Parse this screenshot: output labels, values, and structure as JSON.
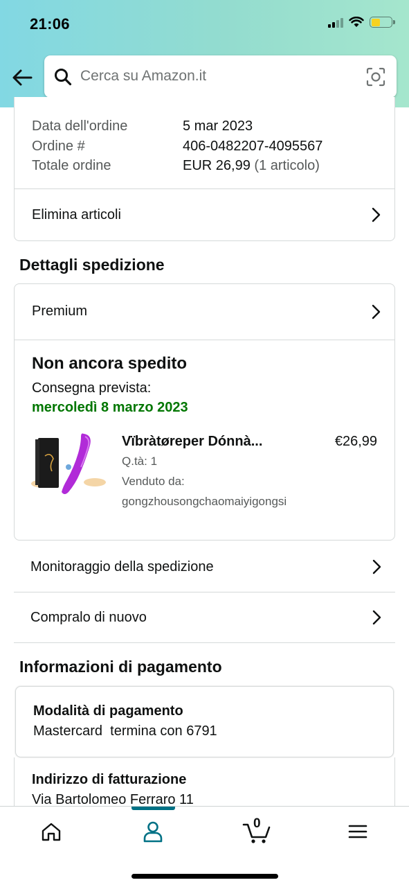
{
  "status_bar": {
    "time": "21:06"
  },
  "search": {
    "placeholder": "Cerca su Amazon.it"
  },
  "order": {
    "date_label": "Data dell'ordine",
    "date_value": "5 mar 2023",
    "number_label": "Ordine #",
    "number_value": "406-0482207-4095567",
    "total_label": "Totale ordine",
    "total_value": "EUR 26,99",
    "total_items": "(1 articolo)",
    "delete_items": "Elimina articoli"
  },
  "shipping": {
    "section_title": "Dettagli spedizione",
    "premium_label": "Premium",
    "status": "Non ancora spedito",
    "delivery_label": "Consegna prevista:",
    "delivery_date": "mercoledì 8 marzo 2023",
    "delivery_color": "#007600",
    "item": {
      "title": "Vïbràtøreper Dónnà...",
      "price": "€26,99",
      "qty": "Q.tà: 1",
      "sold_by_label": "Venduto da:",
      "seller": "gongzhousongchaomaiyigongsi"
    },
    "track_label": "Monitoraggio della spedizione",
    "buy_again_label": "Compralo di nuovo"
  },
  "payment": {
    "section_title": "Informazioni di pagamento",
    "method_title": "Modalità di pagamento",
    "method_value": "Mastercard  termina con 6791",
    "billing_title": "Indirizzo di fatturazione",
    "billing_value": "Via Bartolomeo Ferraro 11"
  },
  "bottom_nav": {
    "items": [
      "home-icon",
      "account-icon",
      "cart-icon",
      "menu-icon"
    ],
    "cart_count": "0",
    "active_color": "#007185"
  }
}
